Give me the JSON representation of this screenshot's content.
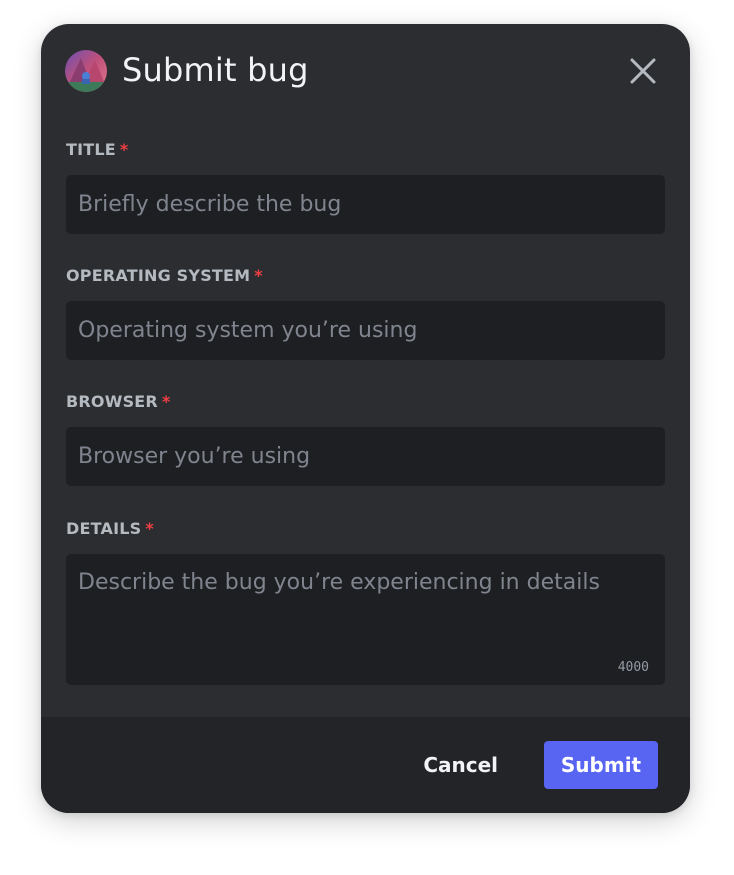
{
  "dialog": {
    "title": "Submit bug",
    "avatar_icon": "user-avatar"
  },
  "fields": [
    {
      "label": "TITLE",
      "required_mark": "*",
      "placeholder": "Briefly describe the bug",
      "value": ""
    },
    {
      "label": "OPERATING SYSTEM",
      "required_mark": "*",
      "placeholder": "Operating system you’re using",
      "value": ""
    },
    {
      "label": "BROWSER",
      "required_mark": "*",
      "placeholder": "Browser you’re using",
      "value": ""
    },
    {
      "label": "DETAILS",
      "required_mark": "*",
      "placeholder": "Describe the bug you’re experiencing in details",
      "value": "",
      "char_limit": "4000"
    }
  ],
  "footer": {
    "cancel_label": "Cancel",
    "submit_label": "Submit"
  },
  "colors": {
    "background": "#2b2d31",
    "input_bg": "#1e1f22",
    "footer_bg": "#232428",
    "accent": "#5865f2",
    "required": "#f23f43"
  },
  "icons": {
    "close": "close-icon"
  }
}
